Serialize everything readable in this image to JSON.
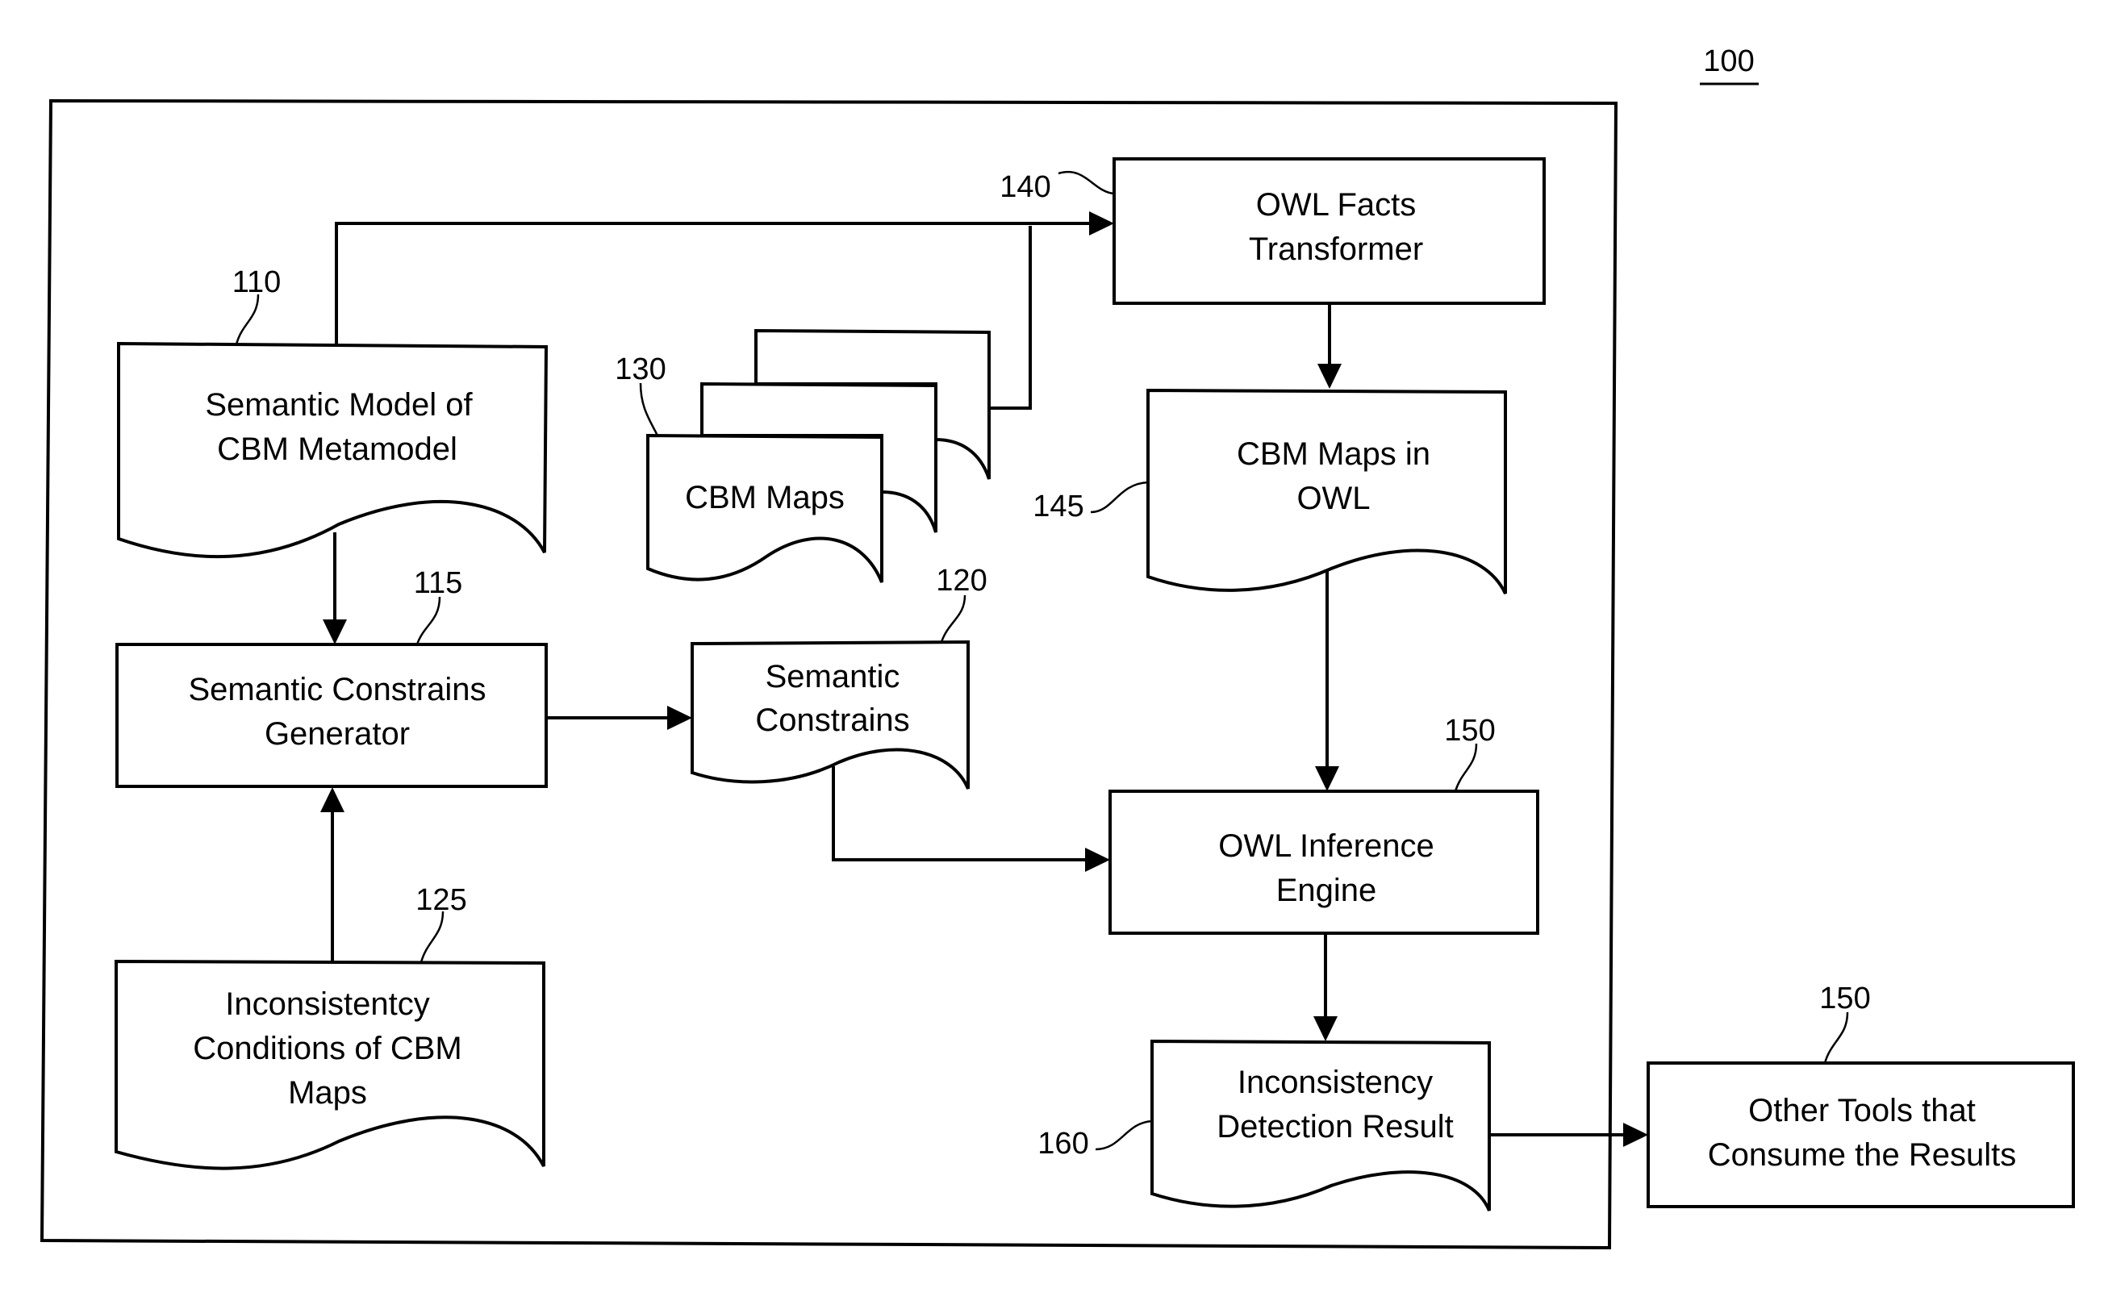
{
  "figure": {
    "number": "100"
  },
  "nodes": {
    "semantic_model": {
      "ref": "110",
      "lines": [
        "Semantic Model of",
        "CBM Metamodel"
      ],
      "shape": "document"
    },
    "constraints_generator": {
      "ref": "115",
      "lines": [
        "Semantic Constrains",
        "Generator"
      ],
      "shape": "process"
    },
    "semantic_constraints": {
      "ref": "120",
      "lines": [
        "Semantic",
        "Constrains"
      ],
      "shape": "document"
    },
    "inconsistency_conditions": {
      "ref": "125",
      "lines": [
        "Inconsistentcy",
        "Conditions of  CBM",
        "Maps"
      ],
      "shape": "document"
    },
    "cbm_maps": {
      "ref": "130",
      "lines": [
        "CBM Maps"
      ],
      "shape": "multi-document"
    },
    "owl_facts_transformer": {
      "ref": "140",
      "lines": [
        "OWL Facts",
        "Transformer"
      ],
      "shape": "process"
    },
    "cbm_maps_owl": {
      "ref": "145",
      "lines": [
        "CBM Maps in",
        "OWL"
      ],
      "shape": "document"
    },
    "owl_inference_engine": {
      "ref": "150",
      "lines": [
        "OWL Inference",
        "Engine"
      ],
      "shape": "process"
    },
    "detection_result": {
      "ref": "160",
      "lines": [
        "Inconsistency",
        "Detection Result"
      ],
      "shape": "document"
    },
    "other_tools": {
      "ref": "150",
      "lines": [
        "Other  Tools that",
        "Consume  the Results"
      ],
      "shape": "process"
    }
  },
  "edges": [
    {
      "from": "semantic_model",
      "to": "owl_facts_transformer"
    },
    {
      "from": "cbm_maps",
      "to": "owl_facts_transformer"
    },
    {
      "from": "semantic_model",
      "to": "constraints_generator"
    },
    {
      "from": "inconsistency_conditions",
      "to": "constraints_generator"
    },
    {
      "from": "constraints_generator",
      "to": "semantic_constraints"
    },
    {
      "from": "owl_facts_transformer",
      "to": "cbm_maps_owl"
    },
    {
      "from": "cbm_maps_owl",
      "to": "owl_inference_engine"
    },
    {
      "from": "semantic_constraints",
      "to": "owl_inference_engine"
    },
    {
      "from": "owl_inference_engine",
      "to": "detection_result"
    },
    {
      "from": "detection_result",
      "to": "other_tools"
    }
  ]
}
